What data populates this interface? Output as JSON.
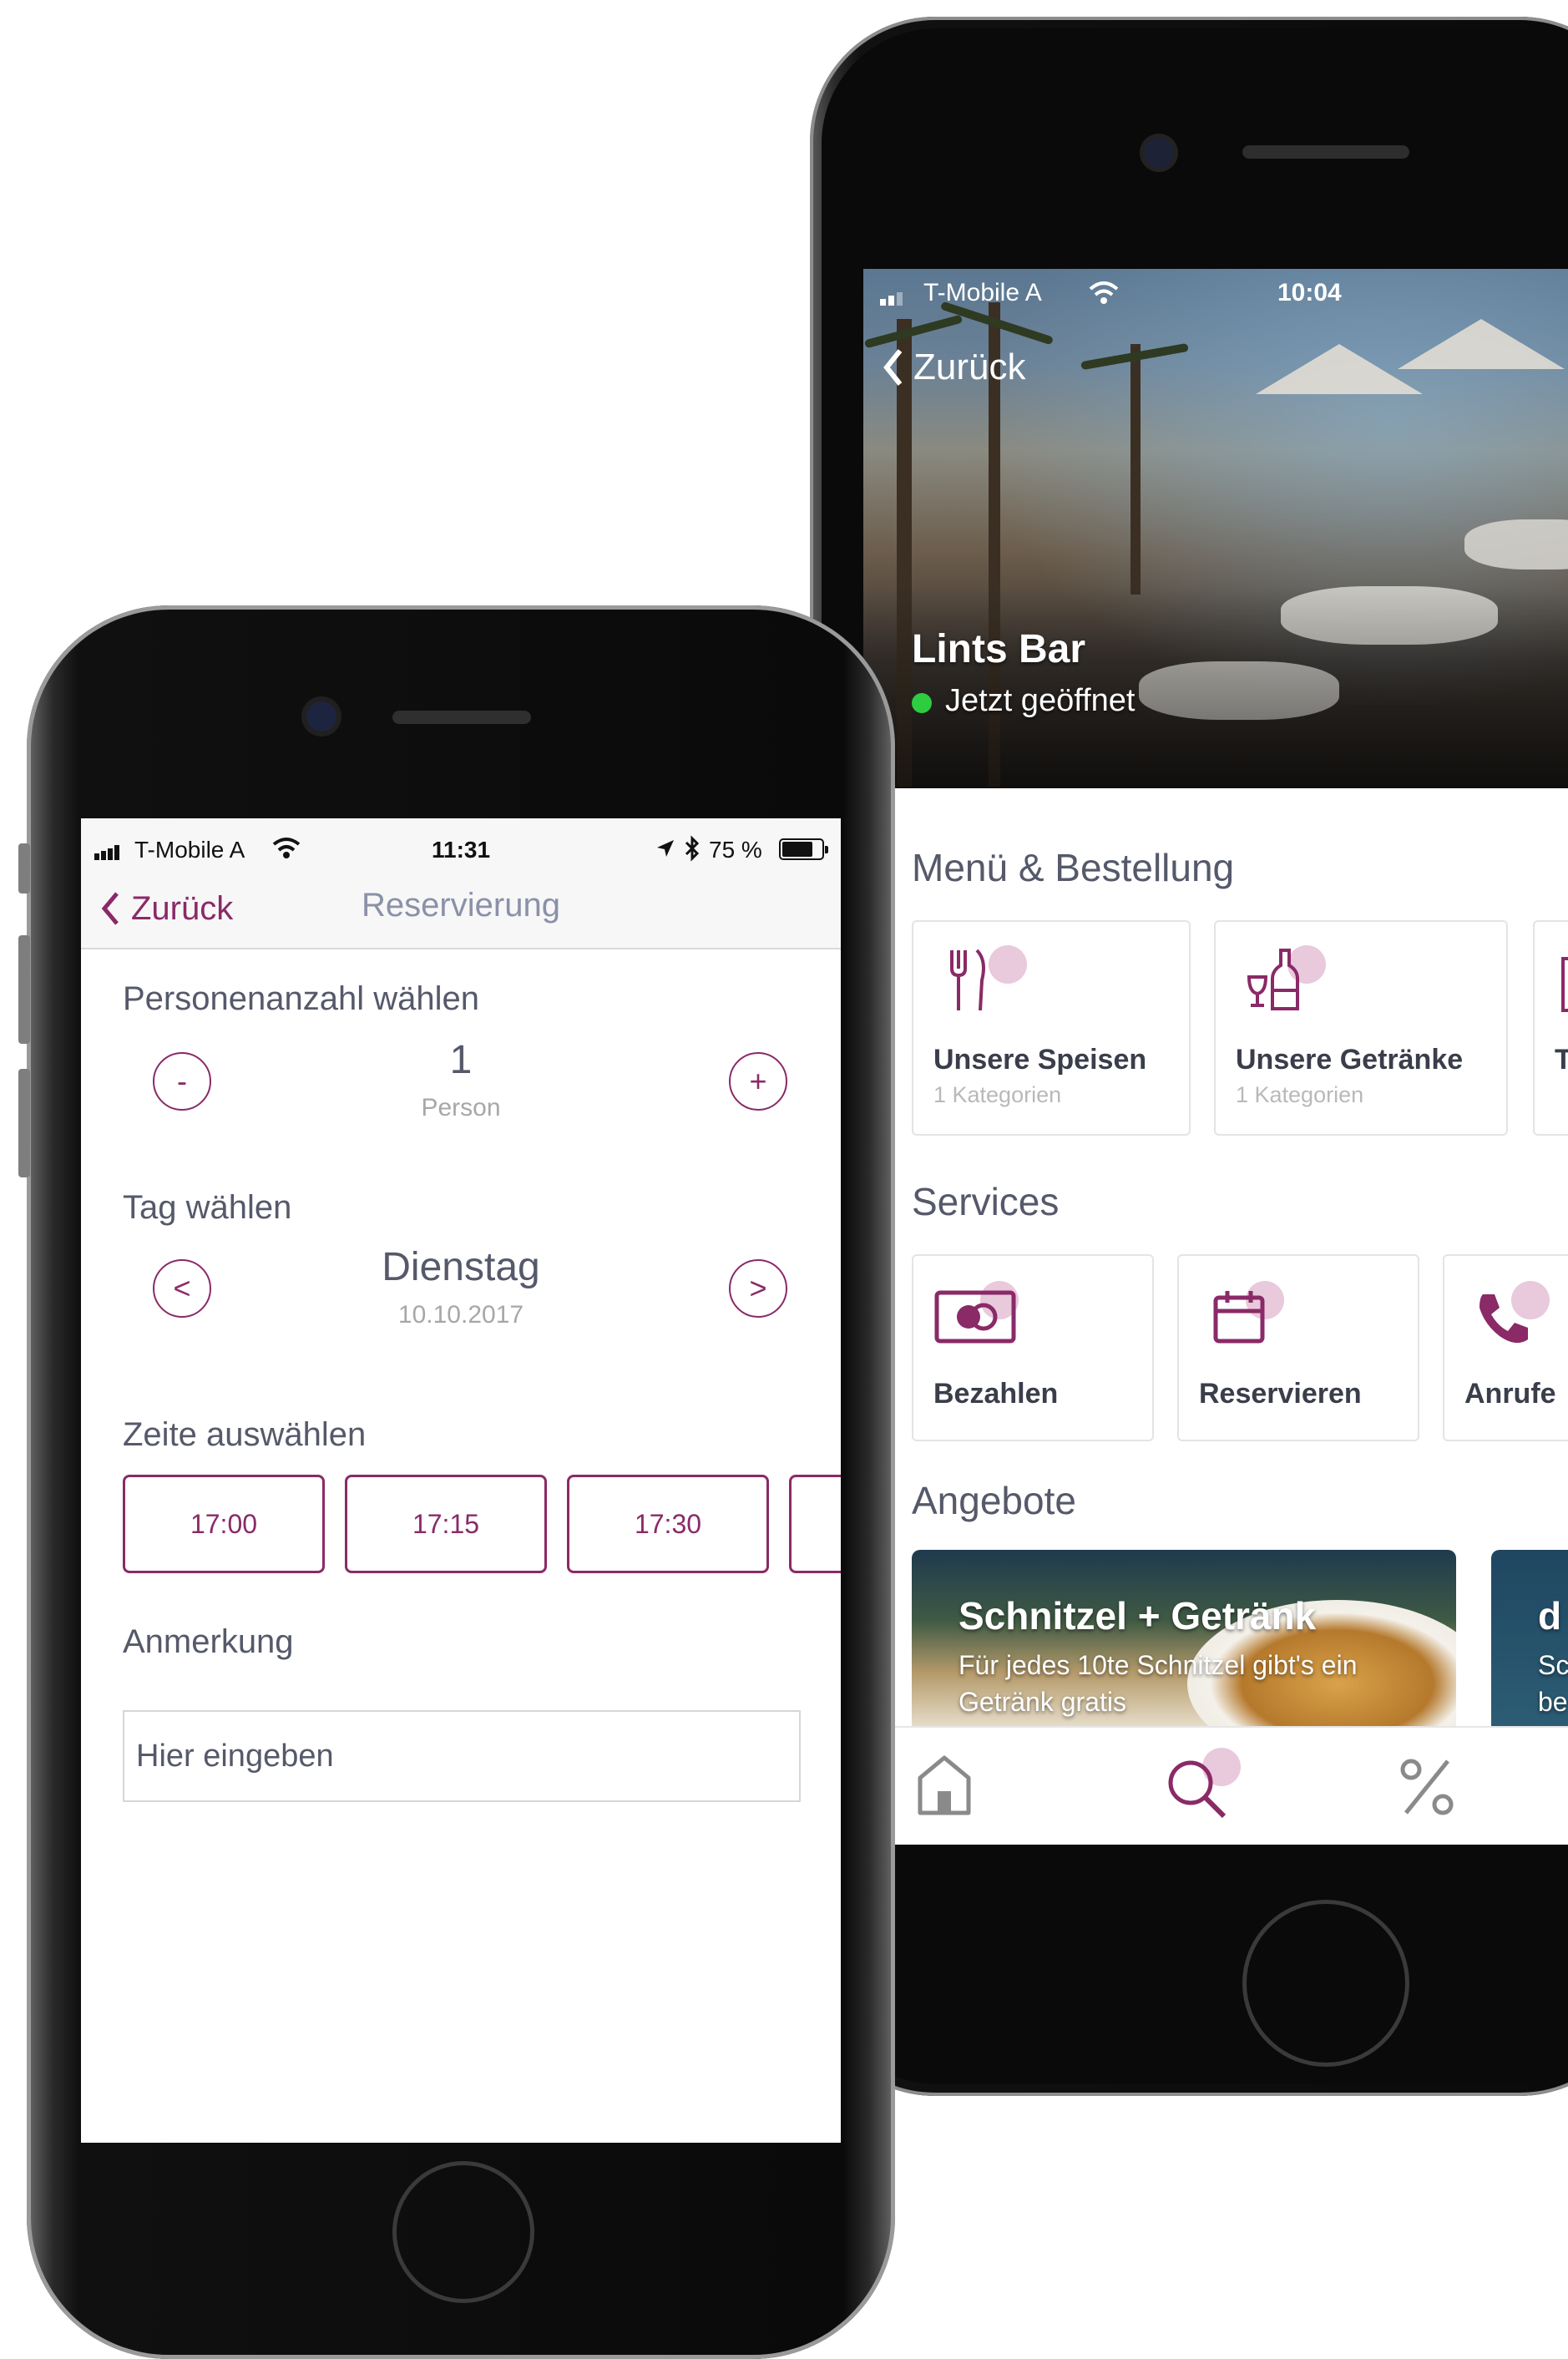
{
  "back_phone": {
    "status": {
      "carrier": "T-Mobile A",
      "time": "10:04"
    },
    "nav": {
      "back_label": "Zurück"
    },
    "venue": {
      "name": "Lints Bar",
      "status": "Jetzt geöffnet",
      "status_color": "#2ecc40"
    },
    "menu_section": {
      "title": "Menü & Bestellung",
      "cards": [
        {
          "icon": "cutlery-icon",
          "title": "Unsere Speisen",
          "subtitle": "1 Kategorien"
        },
        {
          "icon": "drinks-icon",
          "title": "Unsere Getränke",
          "subtitle": "1 Kategorien"
        },
        {
          "icon": "menu-card-icon",
          "title": "T",
          "subtitle": ""
        }
      ]
    },
    "services_section": {
      "title": "Services",
      "cards": [
        {
          "icon": "payment-icon",
          "title": "Bezahlen"
        },
        {
          "icon": "calendar-icon",
          "title": "Reservieren"
        },
        {
          "icon": "phone-icon",
          "title": "Anrufe"
        }
      ]
    },
    "offers_section": {
      "title": "Angebote",
      "offers": [
        {
          "title": "Schnitzel + Getränk",
          "text": "Für jedes 10te Schnitzel gibt's ein Getränk gratis"
        },
        {
          "title": "d",
          "text": "Sc be"
        }
      ]
    },
    "tabbar": {
      "items": [
        "home-icon",
        "search-icon",
        "percent-icon"
      ]
    }
  },
  "front_phone": {
    "status": {
      "carrier": "T-Mobile A",
      "time": "11:31",
      "battery": "75 %"
    },
    "nav": {
      "back_label": "Zurück",
      "title": "Reservierung"
    },
    "persons": {
      "label": "Personenanzahl wählen",
      "decrement": "-",
      "increment": "+",
      "value": "1",
      "unit": "Person"
    },
    "day": {
      "label": "Tag wählen",
      "prev": "<",
      "next": ">",
      "weekday": "Dienstag",
      "date": "10.10.2017"
    },
    "times": {
      "label": "Zeite auswählen",
      "slots": [
        "17:00",
        "17:15",
        "17:30",
        ""
      ]
    },
    "note": {
      "label": "Anmerkung",
      "placeholder": "Hier eingeben"
    }
  },
  "colors": {
    "accent": "#8a2a67",
    "text": "#55596a",
    "muted": "#a7a7a7"
  }
}
